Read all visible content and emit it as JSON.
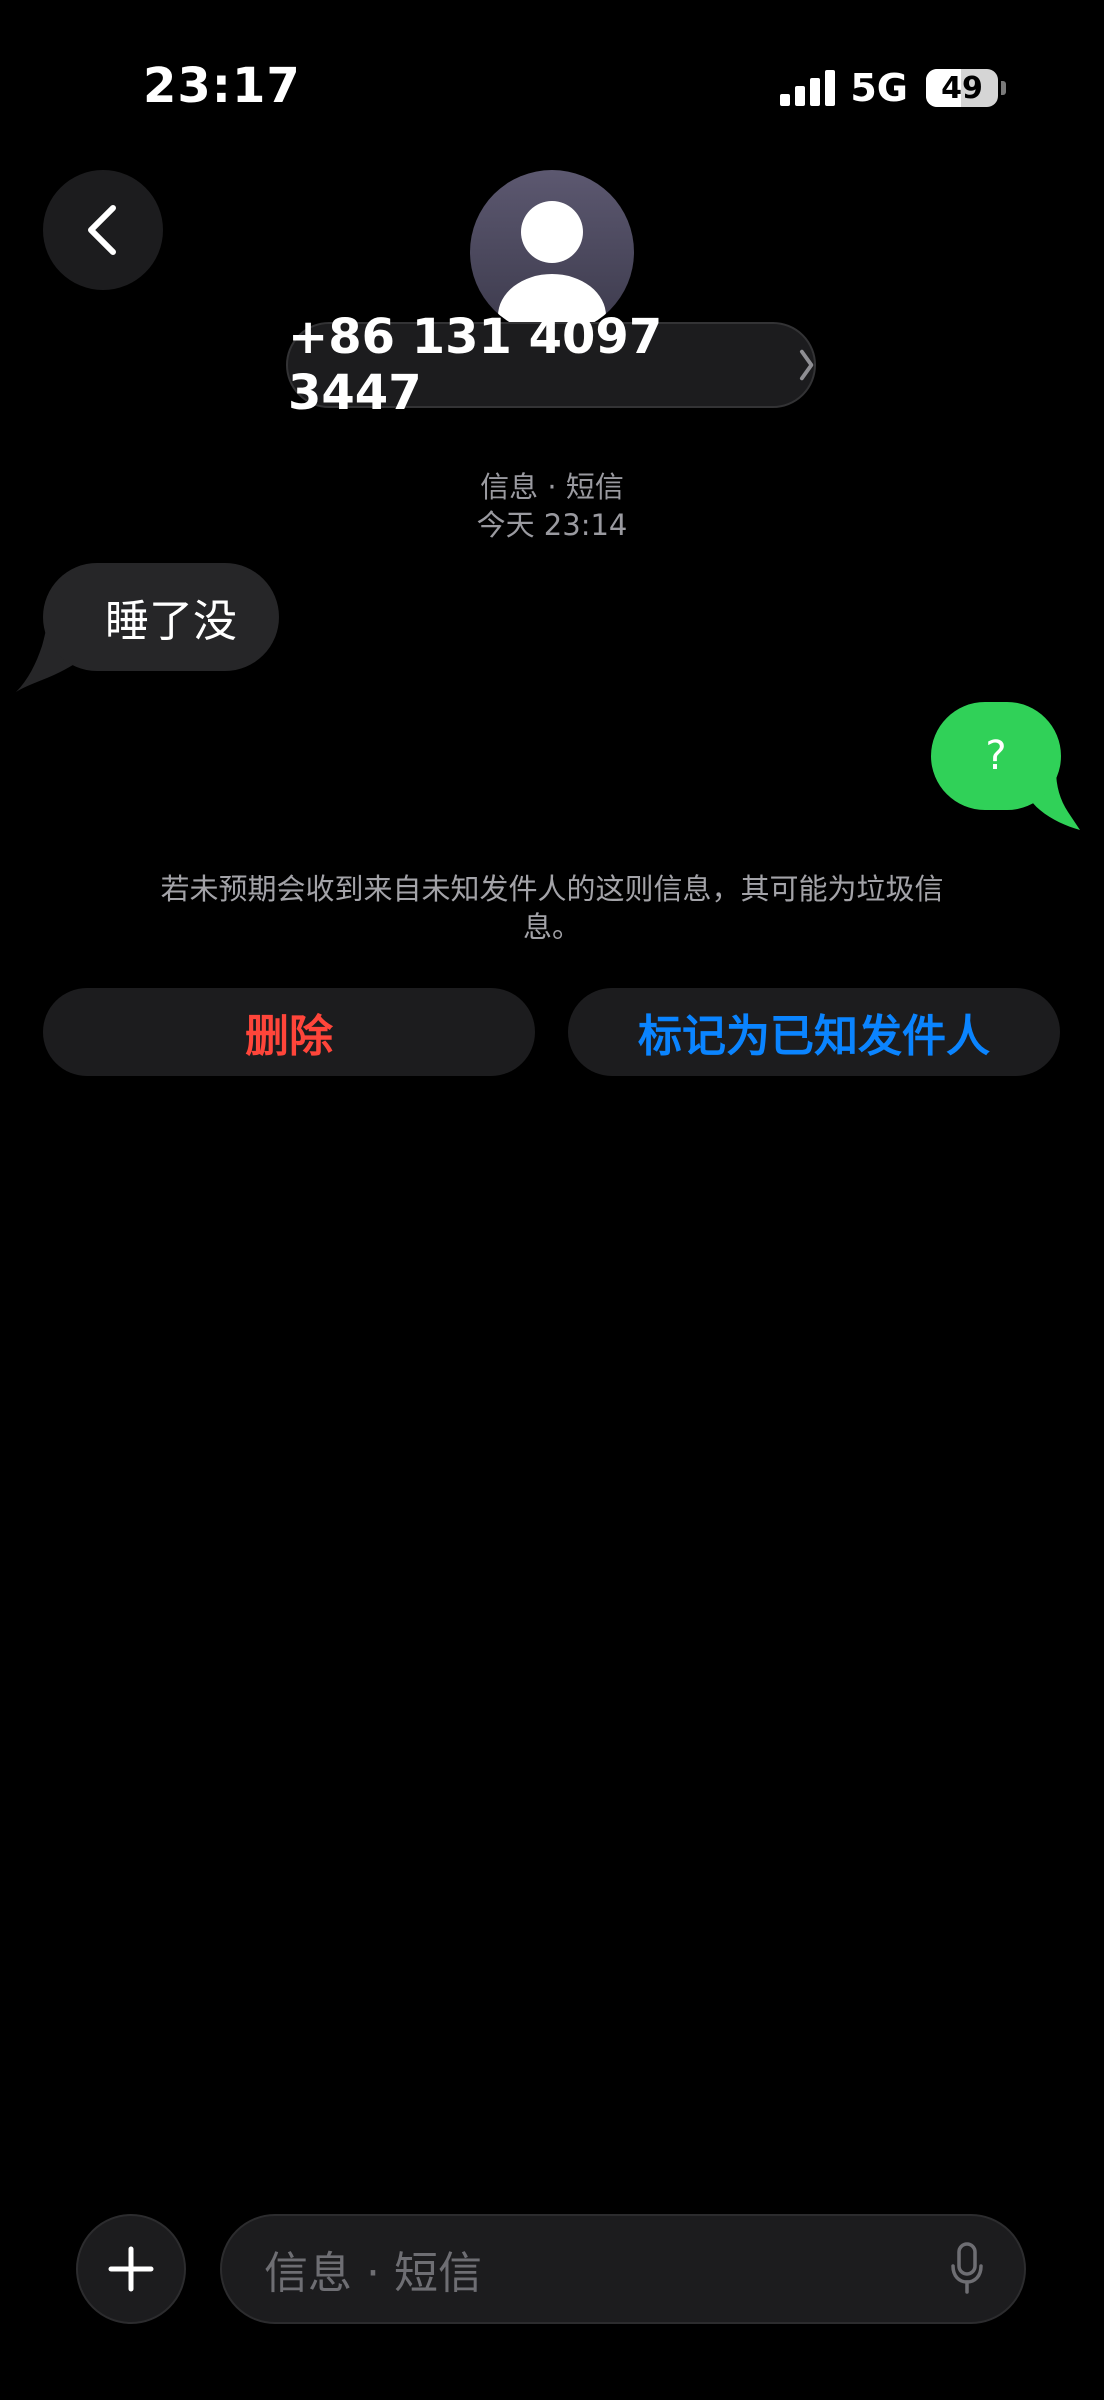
{
  "status_bar": {
    "time": "23:17",
    "network": "5G",
    "battery_level": "49",
    "battery_fraction": 0.49
  },
  "header": {
    "contact_number": "+86 131 4097 3447",
    "back_icon": "chevron-left-icon",
    "avatar_icon": "person-silhouette-icon",
    "disclosure_icon": "chevron-right-icon"
  },
  "conversation": {
    "service_label": "信息 · 短信",
    "timestamp": "今天 23:14",
    "messages": [
      {
        "direction": "incoming",
        "text": "睡了没"
      },
      {
        "direction": "outgoing",
        "text": "?"
      }
    ]
  },
  "spam_notice": {
    "text": "若未预期会收到来自未知发件人的这则信息，其可能为垃圾信息。"
  },
  "actions": {
    "delete_label": "删除",
    "mark_known_label": "标记为已知发件人"
  },
  "composer": {
    "placeholder": "信息 · 短信",
    "add_icon": "plus-icon",
    "mic_icon": "microphone-icon"
  },
  "colors": {
    "background": "#000000",
    "incoming_bubble": "#262628",
    "outgoing_bubble": "#30d158",
    "delete": "#ff453a",
    "link_blue": "#0a84ff"
  }
}
